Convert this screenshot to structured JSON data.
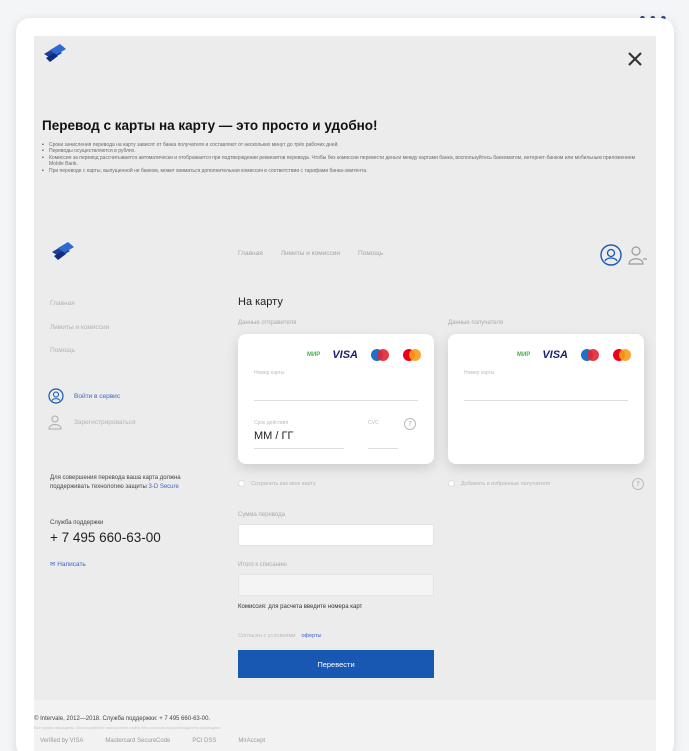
{
  "window": {
    "menu_dots": "•••"
  },
  "header": {
    "title": "Перевод с карты на карту — это просто и удобно!"
  },
  "info_bullets": [
    "Сроки зачисления перевода на карту зависят от банка получателя и составляют от нескольких минут до трёх рабочих дней.",
    "Переводы осуществляются в рублях.",
    "Комиссия за перевод рассчитывается автоматически и отображается при подтверждении реквизитов перевода. Чтобы без комиссии перевести деньги между картами банка, воспользуйтесь банкоматом, интернет-банком или мобильным приложением Mobile Bank.",
    "При переводе с карты, выпущенной не банком, может взиматься дополнительная комиссия в соответствии с тарифами банка-эмитента."
  ],
  "top_nav": [
    "Главная",
    "Лимиты и комиссии",
    "Помощь"
  ],
  "sidebar": {
    "links": [
      "Главная",
      "Лимиты и комиссии",
      "Помощь"
    ],
    "login": "Войти в сервис",
    "register": "Зарегистрироваться",
    "hint": "Для совершения перевода ваша карта должна поддерживать технологию защиты",
    "hint_link": "3-D Secure",
    "support_label": "Служба поддержки",
    "phone": "+ 7 495 660-63-00",
    "write": "Написать"
  },
  "form": {
    "heading": "На карту",
    "sender_label": "Данные отправителя",
    "receiver_label": "Данные получателя",
    "brand_mir": "МИР",
    "brand_visa": "VISA",
    "card_number_label": "Номер карты",
    "expiry_label": "Срок действия",
    "cvc_label": "CVC",
    "expiry_value": "ММ / ГГ",
    "save_card": "Сохранить как мою карту",
    "add_favorites": "Добавить в избранные получателя",
    "amount_label": "Сумма перевода",
    "total_label": "Итого к списанию",
    "commission_note": "Комиссия: для расчета введите номера карт",
    "agree_text": "Согласен с условиями",
    "agree_link": "оферты",
    "submit": "Перевести"
  },
  "footer": {
    "copyright": "© Intervale, 2012—2018. Служба поддержки: + 7 495 660-63-00.",
    "legal": "Все права защищены. Использование материалов сайта без согласия правообладателя запрещено.",
    "badges": [
      "Verified by VISA",
      "Mastercard SecureCode",
      "PCI DSS",
      "MirAccept"
    ]
  },
  "colors": {
    "accent": "#1858b3",
    "link": "#3d64c4",
    "background": "#ececed"
  }
}
